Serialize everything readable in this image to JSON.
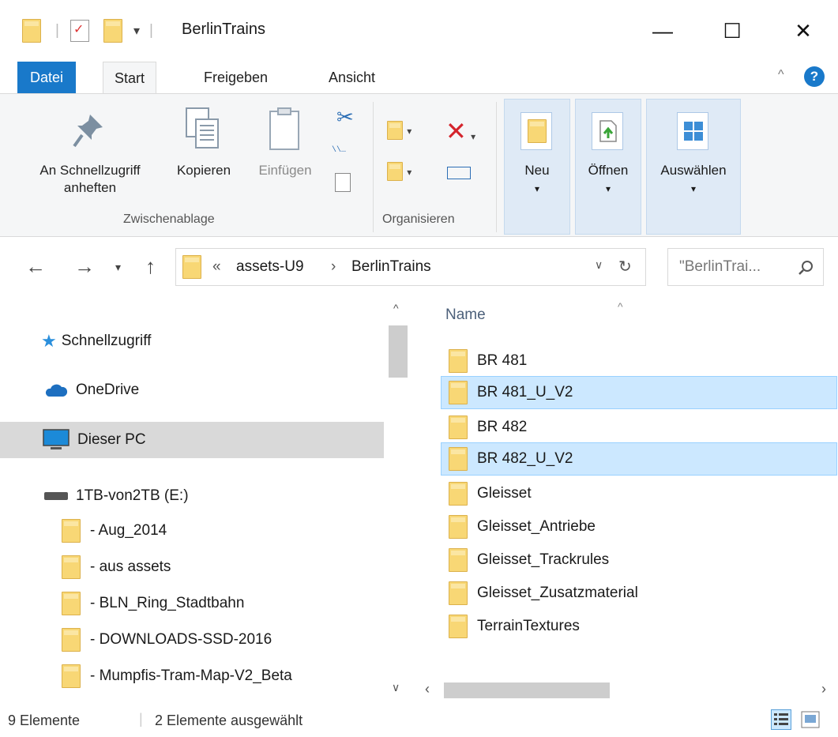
{
  "window": {
    "title": "BerlinTrains",
    "controls": {
      "minimize": "—",
      "maximize": "☐",
      "close": "✕"
    }
  },
  "ribbon_tabs": [
    {
      "label": "Datei"
    },
    {
      "label": "Start"
    },
    {
      "label": "Freigeben"
    },
    {
      "label": "Ansicht"
    }
  ],
  "ribbon": {
    "pin_line1": "An Schnellzugriff",
    "pin_line2": "anheften",
    "copy": "Kopieren",
    "paste": "Einfügen",
    "group_clipboard": "Zwischenablage",
    "group_organize": "Organisieren",
    "new": "Neu",
    "open": "Öffnen",
    "select": "Auswählen"
  },
  "address": {
    "overflow": "«",
    "crumbs": [
      "assets-U9",
      "BerlinTrains"
    ],
    "separator": "›",
    "search_placeholder": "\"BerlinTrai..."
  },
  "nav": {
    "quick_access": "Schnellzugriff",
    "onedrive": "OneDrive",
    "this_pc": "Dieser PC",
    "drive": "1TB-von2TB (E:)",
    "folders": [
      "- Aug_2014",
      "- aus assets",
      "- BLN_Ring_Stadtbahn",
      "- DOWNLOADS-SSD-2016",
      "- Mumpfis-Tram-Map-V2_Beta"
    ]
  },
  "content": {
    "column_name": "Name",
    "items": [
      {
        "name": "BR 481",
        "selected": false
      },
      {
        "name": "BR 481_U_V2",
        "selected": true
      },
      {
        "name": "BR 482",
        "selected": false
      },
      {
        "name": "BR 482_U_V2",
        "selected": true
      },
      {
        "name": "Gleisset",
        "selected": false
      },
      {
        "name": "Gleisset_Antriebe",
        "selected": false
      },
      {
        "name": "Gleisset_Trackrules",
        "selected": false
      },
      {
        "name": "Gleisset_Zusatzmaterial",
        "selected": false
      },
      {
        "name": "TerrainTextures",
        "selected": false
      }
    ]
  },
  "status": {
    "count": "9 Elemente",
    "selected": "2 Elemente ausgewählt"
  },
  "colors": {
    "accent": "#1979ca",
    "selection": "#cce8ff",
    "folder": "#f8d775"
  }
}
